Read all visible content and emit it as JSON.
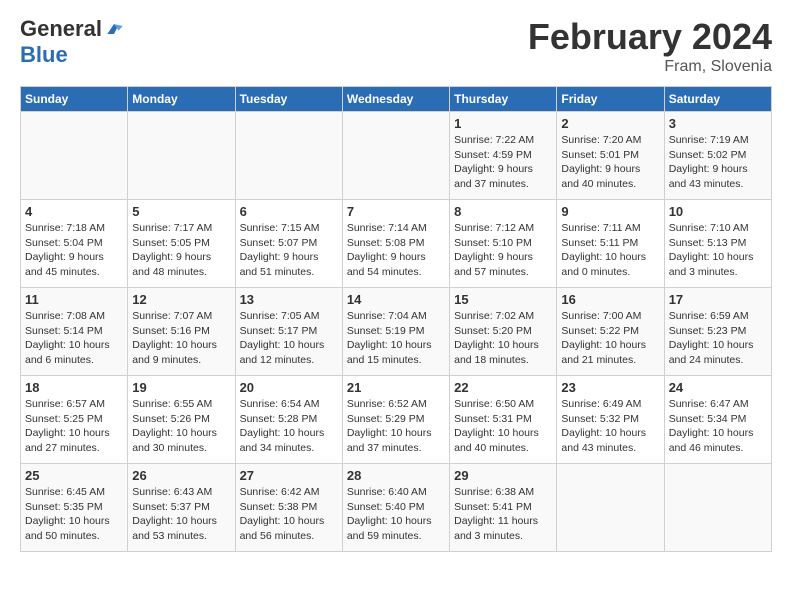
{
  "header": {
    "logo_general": "General",
    "logo_blue": "Blue",
    "month_title": "February 2024",
    "location": "Fram, Slovenia"
  },
  "days_of_week": [
    "Sunday",
    "Monday",
    "Tuesday",
    "Wednesday",
    "Thursday",
    "Friday",
    "Saturday"
  ],
  "weeks": [
    {
      "days": [
        {
          "num": "",
          "info": ""
        },
        {
          "num": "",
          "info": ""
        },
        {
          "num": "",
          "info": ""
        },
        {
          "num": "",
          "info": ""
        },
        {
          "num": "1",
          "info": "Sunrise: 7:22 AM\nSunset: 4:59 PM\nDaylight: 9 hours\nand 37 minutes."
        },
        {
          "num": "2",
          "info": "Sunrise: 7:20 AM\nSunset: 5:01 PM\nDaylight: 9 hours\nand 40 minutes."
        },
        {
          "num": "3",
          "info": "Sunrise: 7:19 AM\nSunset: 5:02 PM\nDaylight: 9 hours\nand 43 minutes."
        }
      ]
    },
    {
      "days": [
        {
          "num": "4",
          "info": "Sunrise: 7:18 AM\nSunset: 5:04 PM\nDaylight: 9 hours\nand 45 minutes."
        },
        {
          "num": "5",
          "info": "Sunrise: 7:17 AM\nSunset: 5:05 PM\nDaylight: 9 hours\nand 48 minutes."
        },
        {
          "num": "6",
          "info": "Sunrise: 7:15 AM\nSunset: 5:07 PM\nDaylight: 9 hours\nand 51 minutes."
        },
        {
          "num": "7",
          "info": "Sunrise: 7:14 AM\nSunset: 5:08 PM\nDaylight: 9 hours\nand 54 minutes."
        },
        {
          "num": "8",
          "info": "Sunrise: 7:12 AM\nSunset: 5:10 PM\nDaylight: 9 hours\nand 57 minutes."
        },
        {
          "num": "9",
          "info": "Sunrise: 7:11 AM\nSunset: 5:11 PM\nDaylight: 10 hours\nand 0 minutes."
        },
        {
          "num": "10",
          "info": "Sunrise: 7:10 AM\nSunset: 5:13 PM\nDaylight: 10 hours\nand 3 minutes."
        }
      ]
    },
    {
      "days": [
        {
          "num": "11",
          "info": "Sunrise: 7:08 AM\nSunset: 5:14 PM\nDaylight: 10 hours\nand 6 minutes."
        },
        {
          "num": "12",
          "info": "Sunrise: 7:07 AM\nSunset: 5:16 PM\nDaylight: 10 hours\nand 9 minutes."
        },
        {
          "num": "13",
          "info": "Sunrise: 7:05 AM\nSunset: 5:17 PM\nDaylight: 10 hours\nand 12 minutes."
        },
        {
          "num": "14",
          "info": "Sunrise: 7:04 AM\nSunset: 5:19 PM\nDaylight: 10 hours\nand 15 minutes."
        },
        {
          "num": "15",
          "info": "Sunrise: 7:02 AM\nSunset: 5:20 PM\nDaylight: 10 hours\nand 18 minutes."
        },
        {
          "num": "16",
          "info": "Sunrise: 7:00 AM\nSunset: 5:22 PM\nDaylight: 10 hours\nand 21 minutes."
        },
        {
          "num": "17",
          "info": "Sunrise: 6:59 AM\nSunset: 5:23 PM\nDaylight: 10 hours\nand 24 minutes."
        }
      ]
    },
    {
      "days": [
        {
          "num": "18",
          "info": "Sunrise: 6:57 AM\nSunset: 5:25 PM\nDaylight: 10 hours\nand 27 minutes."
        },
        {
          "num": "19",
          "info": "Sunrise: 6:55 AM\nSunset: 5:26 PM\nDaylight: 10 hours\nand 30 minutes."
        },
        {
          "num": "20",
          "info": "Sunrise: 6:54 AM\nSunset: 5:28 PM\nDaylight: 10 hours\nand 34 minutes."
        },
        {
          "num": "21",
          "info": "Sunrise: 6:52 AM\nSunset: 5:29 PM\nDaylight: 10 hours\nand 37 minutes."
        },
        {
          "num": "22",
          "info": "Sunrise: 6:50 AM\nSunset: 5:31 PM\nDaylight: 10 hours\nand 40 minutes."
        },
        {
          "num": "23",
          "info": "Sunrise: 6:49 AM\nSunset: 5:32 PM\nDaylight: 10 hours\nand 43 minutes."
        },
        {
          "num": "24",
          "info": "Sunrise: 6:47 AM\nSunset: 5:34 PM\nDaylight: 10 hours\nand 46 minutes."
        }
      ]
    },
    {
      "days": [
        {
          "num": "25",
          "info": "Sunrise: 6:45 AM\nSunset: 5:35 PM\nDaylight: 10 hours\nand 50 minutes."
        },
        {
          "num": "26",
          "info": "Sunrise: 6:43 AM\nSunset: 5:37 PM\nDaylight: 10 hours\nand 53 minutes."
        },
        {
          "num": "27",
          "info": "Sunrise: 6:42 AM\nSunset: 5:38 PM\nDaylight: 10 hours\nand 56 minutes."
        },
        {
          "num": "28",
          "info": "Sunrise: 6:40 AM\nSunset: 5:40 PM\nDaylight: 10 hours\nand 59 minutes."
        },
        {
          "num": "29",
          "info": "Sunrise: 6:38 AM\nSunset: 5:41 PM\nDaylight: 11 hours\nand 3 minutes."
        },
        {
          "num": "",
          "info": ""
        },
        {
          "num": "",
          "info": ""
        }
      ]
    }
  ]
}
